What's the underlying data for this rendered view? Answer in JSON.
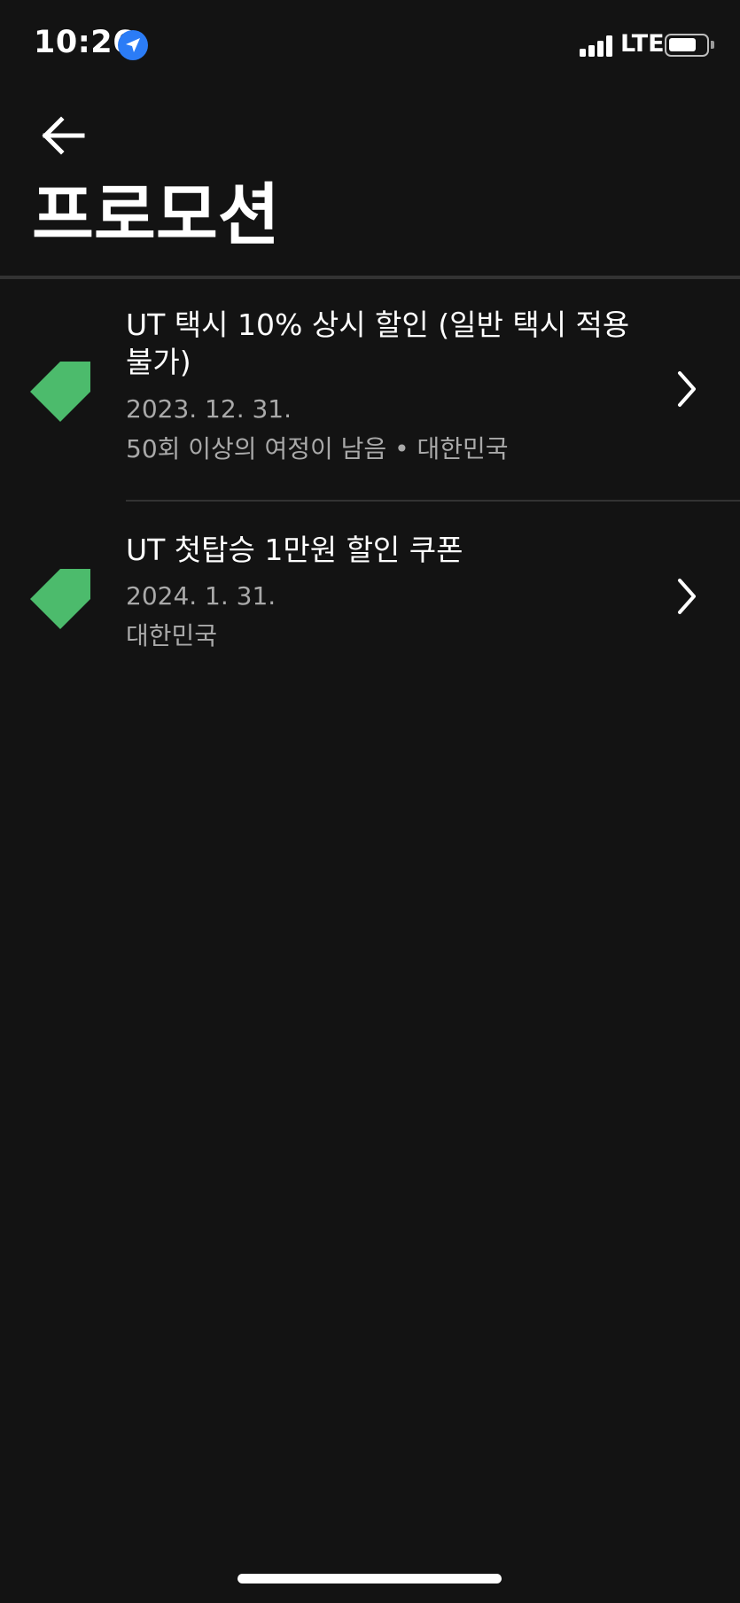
{
  "status_bar": {
    "time": "10:26",
    "network": "LTE"
  },
  "header": {
    "title": "프로모션"
  },
  "promotions": [
    {
      "title": "UT 택시 10% 상시 할인 (일반 택시 적용 불가)",
      "date": "2023. 12. 31.",
      "detail": "50회 이상의 여정이 남음 • 대한민국"
    },
    {
      "title": "UT 첫탑승 1만원 할인 쿠폰",
      "date": "2024. 1. 31.",
      "detail": "대한민국"
    }
  ],
  "colors": {
    "background": "#131313",
    "tag_green": "#4cbb6c",
    "location_blue": "#2b7cf6",
    "secondary_text": "#a9a9a9",
    "divider": "#333333"
  },
  "icons": {
    "back": "arrow-left-icon",
    "tag": "tag-icon",
    "chevron": "chevron-right-icon",
    "location": "location-arrow-icon",
    "signal": "signal-bars-icon",
    "battery": "battery-icon"
  }
}
